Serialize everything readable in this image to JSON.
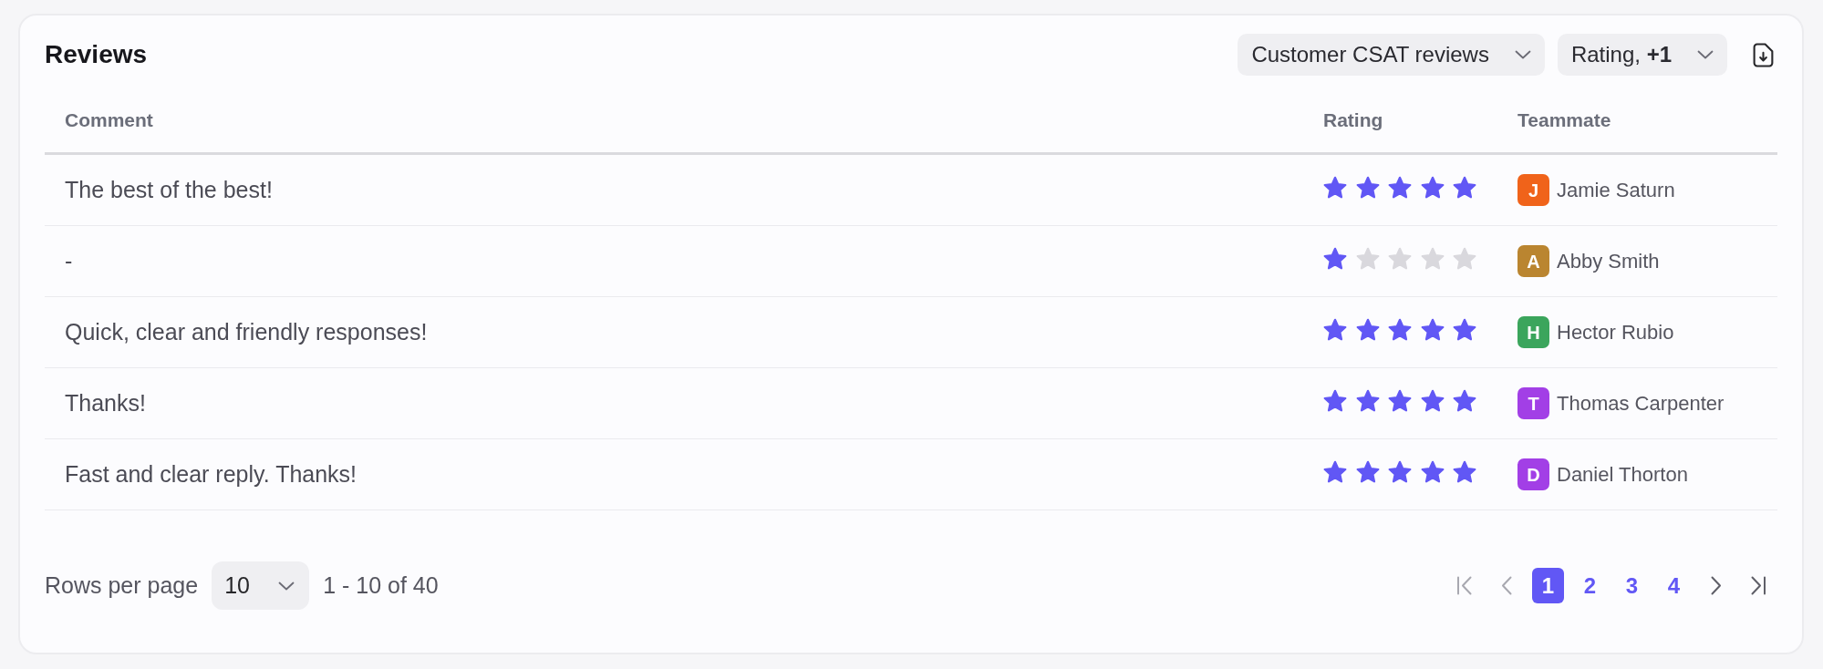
{
  "title": "Reviews",
  "filters": [
    {
      "label": "Customer CSAT reviews"
    },
    {
      "label": "Rating, **+1**"
    }
  ],
  "table": {
    "columns": [
      "Comment",
      "Rating",
      "Teammate"
    ],
    "rows": [
      {
        "comment": "The best of the best!",
        "stars": 5,
        "teammate": {
          "initial": "J",
          "name": "Jamie Saturn",
          "color": "#f0631a"
        }
      },
      {
        "comment": "-",
        "stars": 1,
        "teammate": {
          "initial": "A",
          "name": "Abby Smith",
          "color": "#ba8530"
        }
      },
      {
        "comment": "Quick, clear and friendly responses!",
        "stars": 5,
        "teammate": {
          "initial": "H",
          "name": "Hector Rubio",
          "color": "#3ba55c"
        }
      },
      {
        "comment": "Thanks!",
        "stars": 5,
        "teammate": {
          "initial": "T",
          "name": "Thomas Carpenter",
          "color": "#a23fe6"
        }
      },
      {
        "comment": "Fast and clear reply. Thanks!",
        "stars": 5,
        "teammate": {
          "initial": "D",
          "name": "Daniel Thorton",
          "color": "#a23fe6"
        }
      }
    ]
  },
  "pagination": {
    "rows_per_page_label": "Rows per page",
    "rows_per_page": "10",
    "range": "1 - 10 of 40",
    "nav_start": [
      {
        "kind": "first",
        "disabled": true
      },
      {
        "kind": "prev",
        "disabled": true
      }
    ],
    "pages": [
      {
        "label": "1",
        "selected": true
      },
      {
        "label": "2",
        "selected": false
      },
      {
        "label": "3",
        "selected": false
      },
      {
        "label": "4",
        "selected": false
      }
    ],
    "nav_end": [
      {
        "kind": "next",
        "disabled": false
      },
      {
        "kind": "last",
        "disabled": false
      }
    ]
  }
}
